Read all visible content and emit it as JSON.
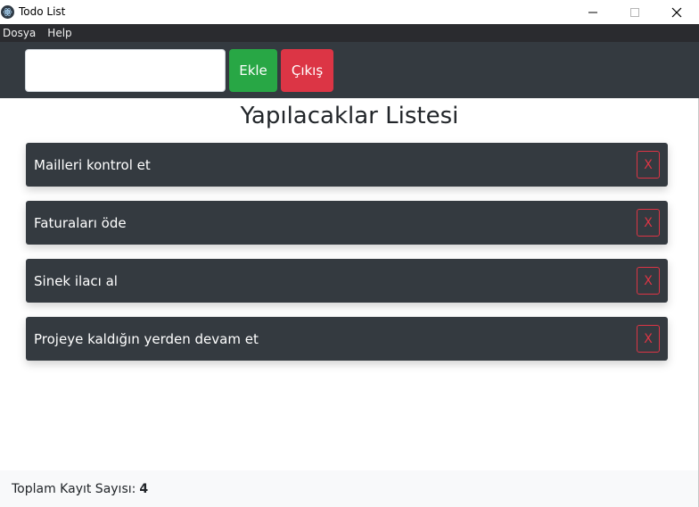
{
  "window": {
    "title": "Todo List"
  },
  "menu": {
    "items": [
      "Dosya",
      "Help"
    ]
  },
  "toolbar": {
    "input_value": "",
    "add_label": "Ekle",
    "exit_label": "Çıkış",
    "add_color": "#28a745",
    "exit_color": "#dc3545"
  },
  "main": {
    "title": "Yapılacaklar Listesi",
    "todos": [
      {
        "text": "Mailleri kontrol et",
        "delete_label": "X"
      },
      {
        "text": "Faturaları öde",
        "delete_label": "X"
      },
      {
        "text": "Sinek ilacı al",
        "delete_label": "X"
      },
      {
        "text": "Projeye kaldığın yerden devam et",
        "delete_label": "X"
      }
    ]
  },
  "footer": {
    "label": "Toplam Kayıt Sayısı:",
    "count": "4"
  },
  "icons": {
    "app": "electron-app-icon",
    "minimize": "minimize-icon",
    "maximize": "maximize-icon",
    "close": "close-icon"
  }
}
